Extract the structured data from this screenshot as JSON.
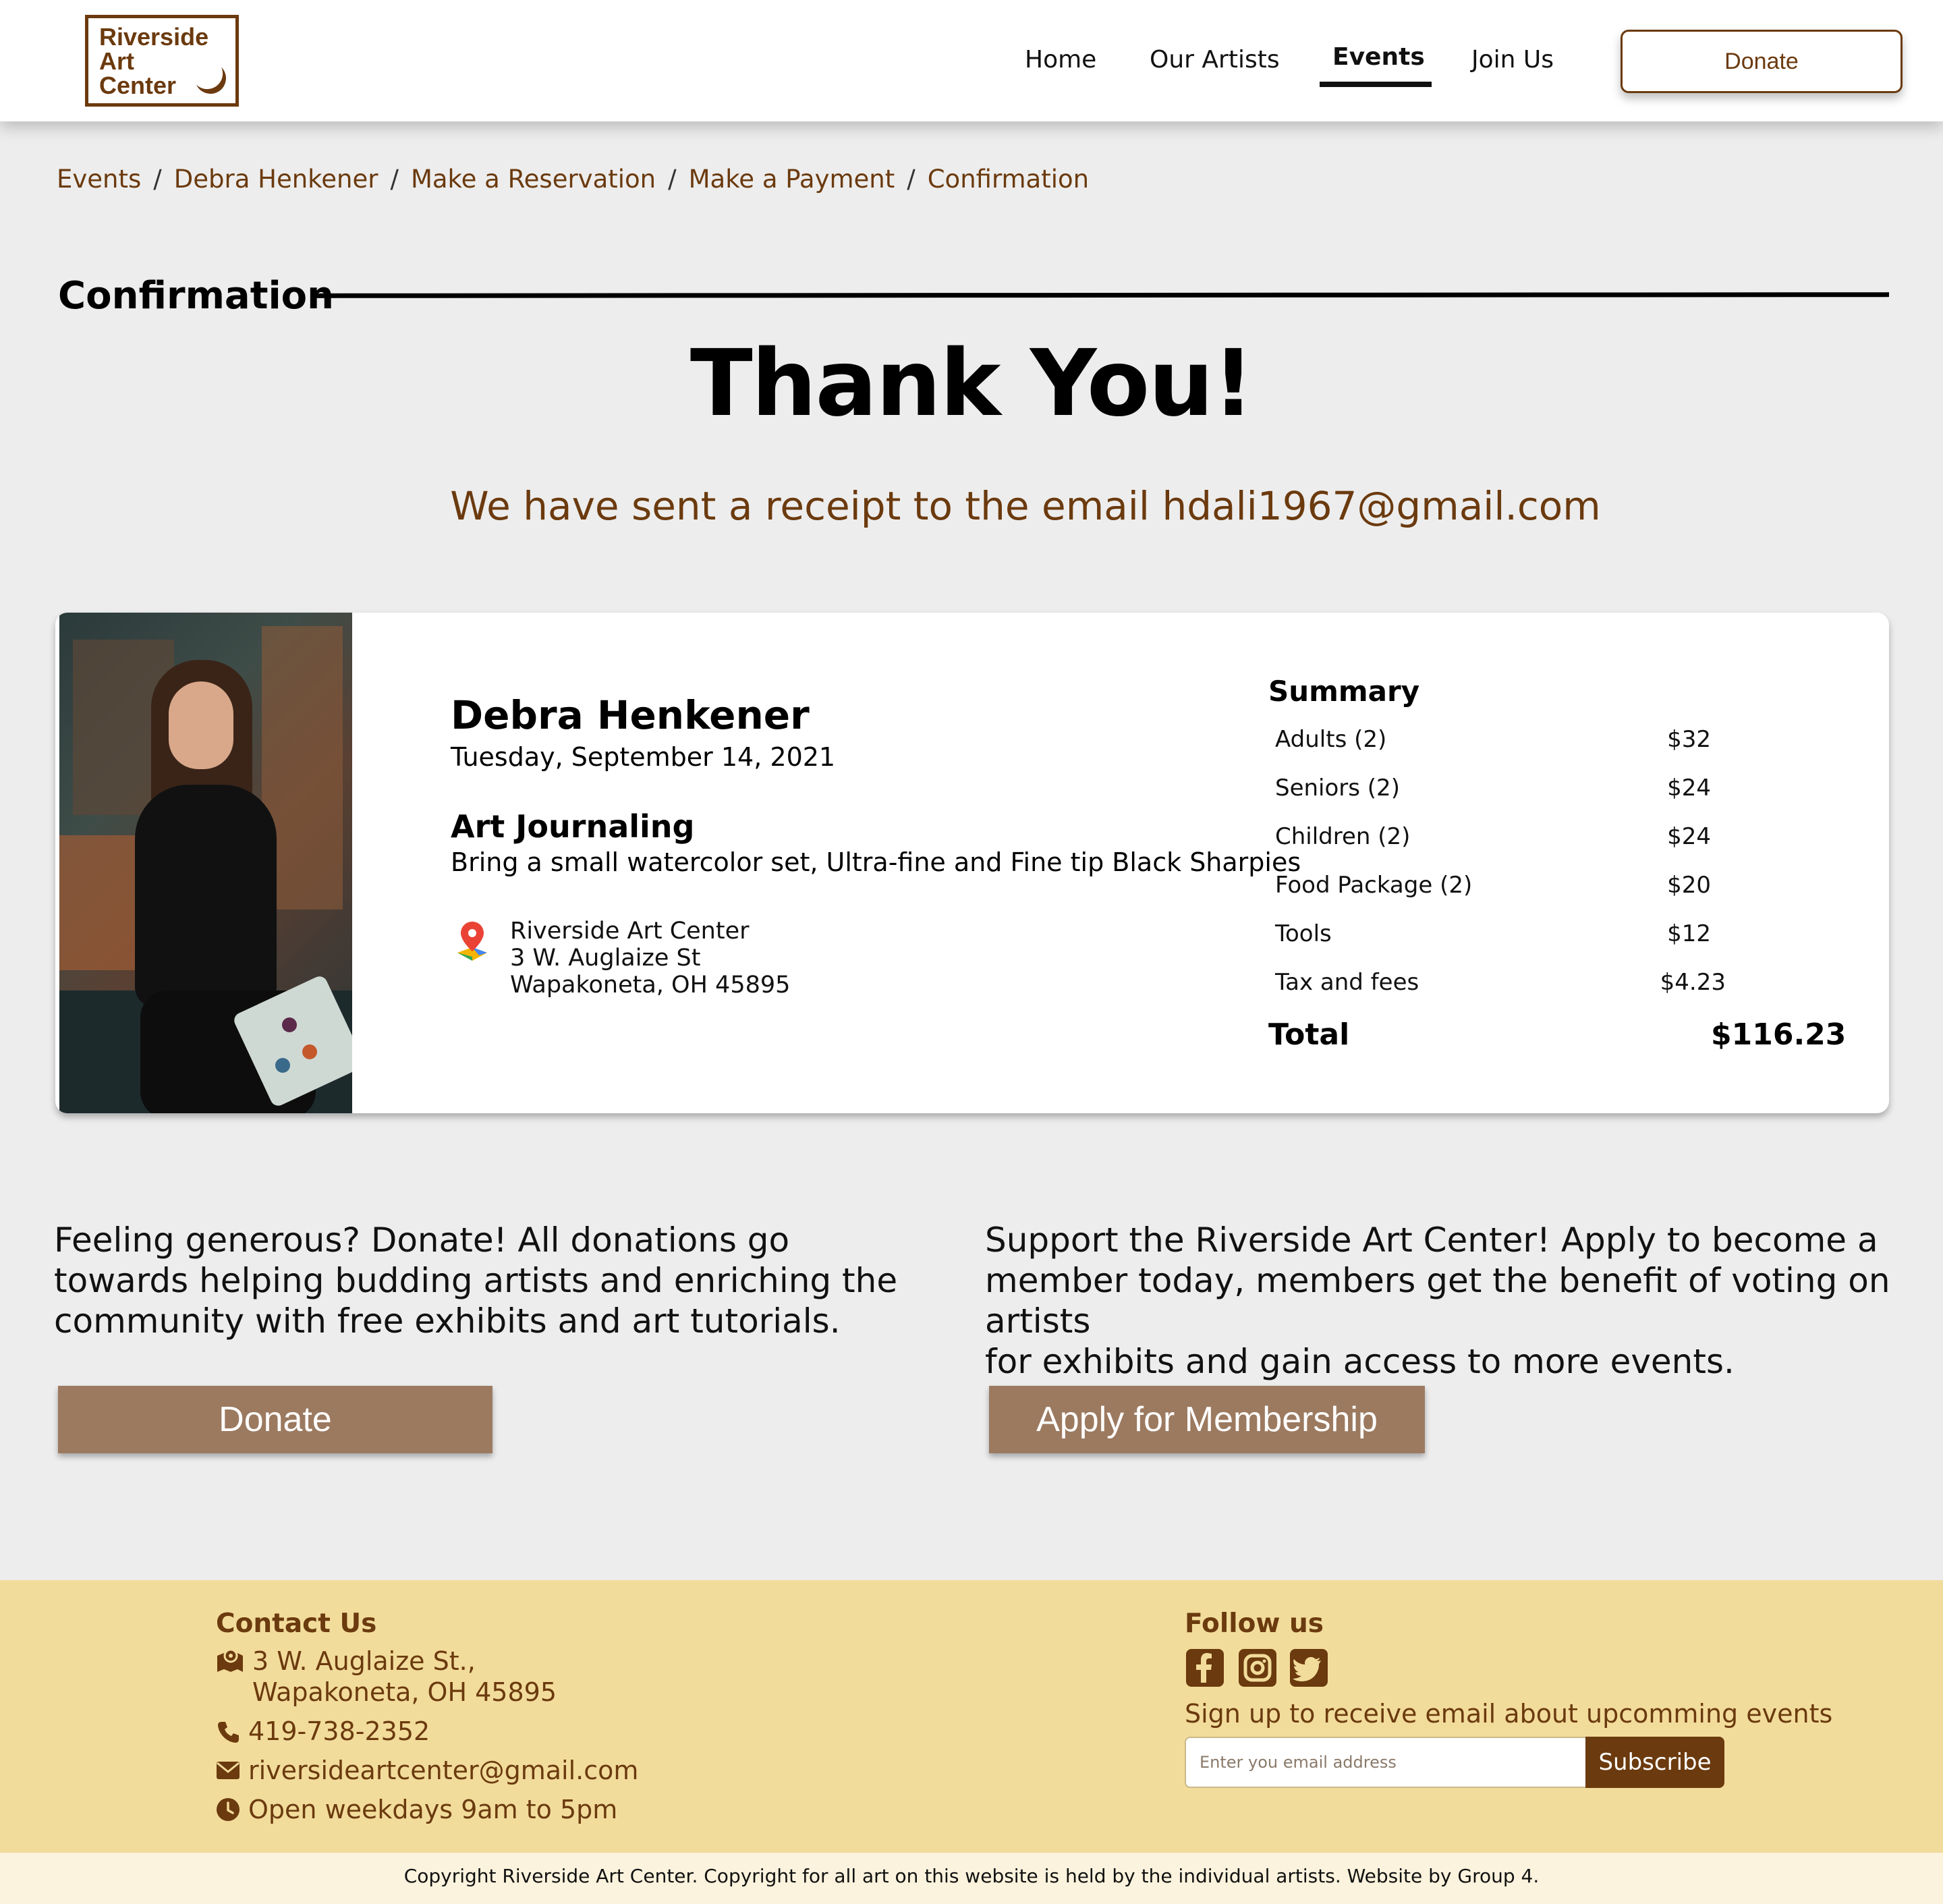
{
  "nav": {
    "logo_lines": [
      "Riverside",
      "Art",
      "Center"
    ],
    "links": [
      "Home",
      "Our Artists",
      "Events",
      "Join Us"
    ],
    "active": "Events",
    "donate_label": "Donate"
  },
  "breadcrumb": [
    "Events",
    "Debra Henkener",
    "Make a Reservation",
    "Make a Payment",
    "Confirmation"
  ],
  "page": {
    "section_title": "Confirmation",
    "thank_you": "Thank You!",
    "receipt_message": "We have sent a receipt to the email hdali1967@gmail.com"
  },
  "event": {
    "artist": "Debra Henkener",
    "date": "Tuesday, September 14, 2021",
    "class_name": "Art Journaling",
    "class_description": "Bring a small watercolor set, Ultra-fine and Fine tip Black Sharpies",
    "venue_name": "Riverside Art Center",
    "venue_street": "3 W. Auglaize St",
    "venue_city": "Wapakoneta, OH 45895",
    "photo_icon": "artist-portrait"
  },
  "summary": {
    "title": "Summary",
    "items": [
      {
        "label": "Adults (2)",
        "amount": "$32"
      },
      {
        "label": "Seniors (2)",
        "amount": "$24"
      },
      {
        "label": "Children (2)",
        "amount": "$24"
      },
      {
        "label": "Food Package (2)",
        "amount": "$20"
      },
      {
        "label": "Tools",
        "amount": "$12"
      },
      {
        "label": "Tax and fees",
        "amount": "$4.23"
      }
    ],
    "total_label": "Total",
    "total_amount": "$116.23"
  },
  "cta": {
    "donate_lines": [
      "Feeling generous? Donate! All donations go",
      "towards helping budding artists and enriching the",
      "community with free exhibits and art tutorials."
    ],
    "donate_button": "Donate",
    "member_lines": [
      "Support the Riverside Art Center! Apply to become a",
      "member today, members get the benefit of voting on artists",
      "for exhibits and gain access to more events."
    ],
    "member_button": "Apply for Membership"
  },
  "footer": {
    "contact_title": "Contact Us",
    "address_line1": "3 W. Auglaize St.,",
    "address_line2": "Wapakoneta, OH 45895",
    "phone": "419-738-2352",
    "email": "riversideartcenter@gmail.com",
    "hours": "Open weekdays 9am to 5pm",
    "follow_title": "Follow us",
    "social_icons": [
      "facebook-icon",
      "instagram-icon",
      "twitter-icon"
    ],
    "signup_text": "Sign up to receive email about upcomming events",
    "email_placeholder": "Enter you email address",
    "subscribe_label": "Subscribe",
    "copyright": "Copyright Riverside Art Center. Copyright for all art on this website is held by the individual artists. Website by Group 4."
  },
  "colors": {
    "brand_brown": "#6b3a0e",
    "button_tan": "#9c7a60",
    "footer_bg": "#f2dc9b",
    "page_bg": "#ededed"
  }
}
